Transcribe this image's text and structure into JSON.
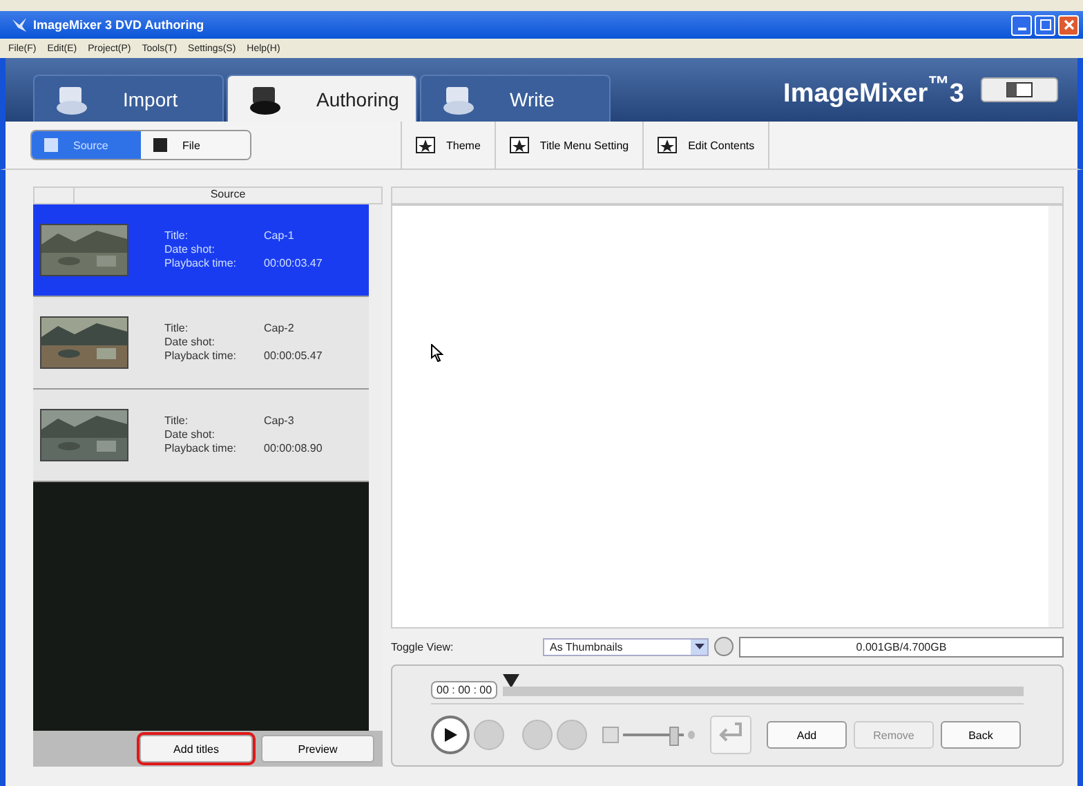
{
  "window": {
    "title": "ImageMixer 3 DVD Authoring"
  },
  "menu": [
    "File(F)",
    "Edit(E)",
    "Project(P)",
    "Tools(T)",
    "Settings(S)",
    "Help(H)"
  ],
  "tabs": [
    {
      "label": "Import",
      "selected": false
    },
    {
      "label": "Authoring",
      "selected": true
    },
    {
      "label": "Write",
      "selected": false
    }
  ],
  "brand": "ImageMixer$^{™}$3",
  "source_toggle": [
    {
      "label": "Source",
      "selected": true
    },
    {
      "label": "File",
      "selected": false
    }
  ],
  "toolbar": [
    "Theme",
    "Title Menu Setting",
    "Edit Contents"
  ],
  "source_list": {
    "header": "Source",
    "items": [
      {
        "selected": true,
        "fields": [
          {
            "label": "Title:",
            "value": "Cap-1"
          },
          {
            "label": "Date shot:"
          },
          {
            "label": "Playback time:",
            "value": "00:00:03.47"
          }
        ]
      },
      {
        "selected": false,
        "fields": [
          {
            "label": "Title:",
            "value": "Cap-2"
          },
          {
            "label": "Date shot:"
          },
          {
            "label": "Playback time:",
            "value": "00:00:05.47"
          }
        ]
      },
      {
        "selected": false,
        "fields": [
          {
            "label": "Title:",
            "value": "Cap-3"
          },
          {
            "label": "Date shot:"
          },
          {
            "label": "Playback time:",
            "value": "00:00:08.90"
          }
        ]
      }
    ]
  },
  "list_buttons": [
    {
      "label": "Add titles",
      "highlighted": true
    },
    {
      "label": "Preview",
      "highlighted": false
    }
  ],
  "toggle_view": {
    "label": "Toggle View:",
    "value": "As Thumbnails"
  },
  "capacity": "0.001GB/4.700GB",
  "player": {
    "timecode": "00 : 00 : 00",
    "seek": {
      "level": 0
    },
    "volume": {
      "level": 0.85
    }
  },
  "actions": [
    {
      "label": "Add",
      "disabled": false
    },
    {
      "label": "Remove",
      "disabled": true
    },
    {
      "label": "Back",
      "disabled": false
    }
  ]
}
